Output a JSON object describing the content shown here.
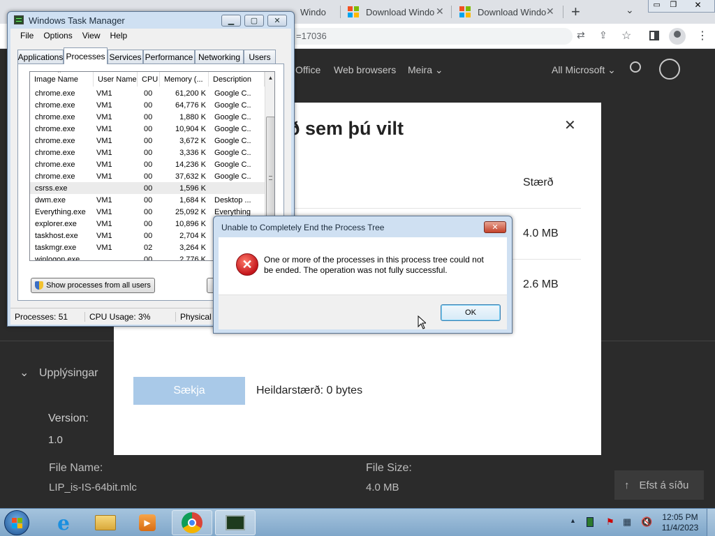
{
  "browser": {
    "tabs": [
      {
        "label": "Windo"
      },
      {
        "label": "Download Windo"
      },
      {
        "label": "Download Windo"
      }
    ],
    "new_tab": "+",
    "address_fragment": "=17036"
  },
  "site_nav": {
    "items": [
      "Office",
      "Web browsers",
      "Meira"
    ],
    "all_microsoft": "All Microsoft"
  },
  "download_modal": {
    "title_fragment": "ð sem þú vilt",
    "size_header": "Stærð",
    "sizes": [
      "4.0 MB",
      "2.6 MB"
    ],
    "download_button": "Sækja",
    "total_size": "Heildarstærð: 0 bytes"
  },
  "page_details": {
    "section": "Upplýsingar",
    "version_label": "Version:",
    "version_value": "1.0",
    "filename_label": "File Name:",
    "filename_value": "LIP_is-IS-64bit.mlc",
    "filesize_label": "File Size:",
    "filesize_value": "4.0 MB",
    "back_to_top": "Efst á síðu"
  },
  "task_manager": {
    "title": "Windows Task Manager",
    "menu": [
      "File",
      "Options",
      "View",
      "Help"
    ],
    "tabs": [
      "Applications",
      "Processes",
      "Services",
      "Performance",
      "Networking",
      "Users"
    ],
    "active_tab": "Processes",
    "columns": [
      "Image Name",
      "User Name",
      "CPU",
      "Memory (...",
      "Description"
    ],
    "processes": [
      {
        "name": "chrome.exe",
        "user": "VM1",
        "cpu": "00",
        "mem": "61,200 K",
        "desc": "Google C..."
      },
      {
        "name": "chrome.exe",
        "user": "VM1",
        "cpu": "00",
        "mem": "64,776 K",
        "desc": "Google C..."
      },
      {
        "name": "chrome.exe",
        "user": "VM1",
        "cpu": "00",
        "mem": "1,880 K",
        "desc": "Google C..."
      },
      {
        "name": "chrome.exe",
        "user": "VM1",
        "cpu": "00",
        "mem": "10,904 K",
        "desc": "Google C..."
      },
      {
        "name": "chrome.exe",
        "user": "VM1",
        "cpu": "00",
        "mem": "3,672 K",
        "desc": "Google C..."
      },
      {
        "name": "chrome.exe",
        "user": "VM1",
        "cpu": "00",
        "mem": "3,336 K",
        "desc": "Google C..."
      },
      {
        "name": "chrome.exe",
        "user": "VM1",
        "cpu": "00",
        "mem": "14,236 K",
        "desc": "Google C..."
      },
      {
        "name": "chrome.exe",
        "user": "VM1",
        "cpu": "00",
        "mem": "37,632 K",
        "desc": "Google C..."
      },
      {
        "name": "csrss.exe",
        "user": "",
        "cpu": "00",
        "mem": "1,596 K",
        "desc": ""
      },
      {
        "name": "dwm.exe",
        "user": "VM1",
        "cpu": "00",
        "mem": "1,684 K",
        "desc": "Desktop ..."
      },
      {
        "name": "Everything.exe",
        "user": "VM1",
        "cpu": "00",
        "mem": "25,092 K",
        "desc": "Everything"
      },
      {
        "name": "explorer.exe",
        "user": "VM1",
        "cpu": "00",
        "mem": "10,896 K",
        "desc": ""
      },
      {
        "name": "taskhost.exe",
        "user": "VM1",
        "cpu": "00",
        "mem": "2,704 K",
        "desc": ""
      },
      {
        "name": "taskmgr.exe",
        "user": "VM1",
        "cpu": "02",
        "mem": "3,264 K",
        "desc": ""
      },
      {
        "name": "winlogon.exe",
        "user": "",
        "cpu": "00",
        "mem": "2,776 K",
        "desc": ""
      }
    ],
    "show_all_button": "Show processes from all users",
    "status": {
      "processes": "Processes: 51",
      "cpu": "CPU Usage: 3%",
      "physical": "Physical"
    }
  },
  "error_dialog": {
    "title": "Unable to Completely End the Process Tree",
    "message": "One or more of the processes in this process tree could not be ended.  The operation was not fully successful.",
    "ok_button": "OK"
  },
  "taskbar": {
    "time": "12:05 PM",
    "date": "11/4/2023"
  }
}
